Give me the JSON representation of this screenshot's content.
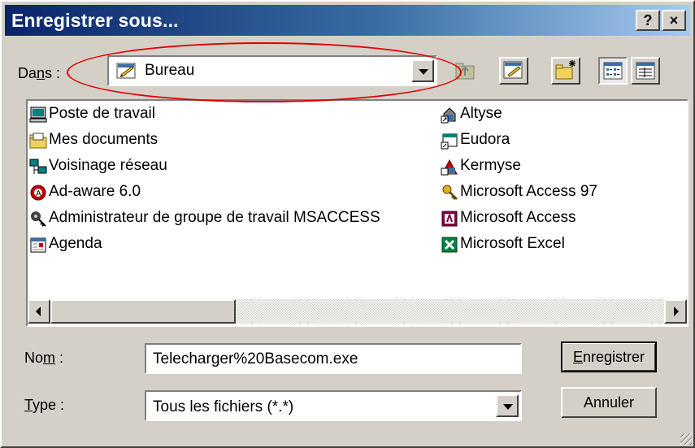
{
  "window": {
    "title": "Enregistrer sous...",
    "help_label": "?",
    "close_label": "×"
  },
  "location": {
    "label_prefix": "Da",
    "label_mnemonic": "n",
    "label_suffix": "s :",
    "value": "Bureau"
  },
  "toolbar": {
    "up_icon": "up-folder-icon",
    "desktop_icon": "desktop-icon",
    "new_folder_icon": "new-folder-icon",
    "list_view_icon": "list-view-icon",
    "details_view_icon": "details-view-icon"
  },
  "files": {
    "left": [
      {
        "label": "Poste de travail",
        "icon": "computer-icon"
      },
      {
        "label": "Mes documents",
        "icon": "folder-icon"
      },
      {
        "label": "Voisinage réseau",
        "icon": "network-icon"
      },
      {
        "label": "Ad-aware 6.0",
        "icon": "adaware-icon"
      },
      {
        "label": "Administrateur de groupe de travail MSACCESS",
        "icon": "admin-key-icon"
      },
      {
        "label": "Agenda",
        "icon": "agenda-icon"
      }
    ],
    "right": [
      {
        "label": "Altyse",
        "icon": "shortcut-icon"
      },
      {
        "label": "Eudora",
        "icon": "eudora-icon"
      },
      {
        "label": "Kermyse",
        "icon": "kermyse-icon"
      },
      {
        "label": "Microsoft Access 97",
        "icon": "key-icon"
      },
      {
        "label": "Microsoft Access",
        "icon": "access-icon"
      },
      {
        "label": "Microsoft Excel",
        "icon": "excel-icon"
      }
    ]
  },
  "name_field": {
    "label_prefix": "No",
    "label_mnemonic": "m",
    "label_suffix": " :",
    "value": "Telecharger%20Basecom.exe"
  },
  "type_field": {
    "label_mnemonic": "T",
    "label_suffix": "ype :",
    "value": "Tous les fichiers (*.*)"
  },
  "buttons": {
    "save_mnemonic": "E",
    "save_suffix": "nregistrer",
    "cancel": "Annuler"
  },
  "colors": {
    "title_gradient_start": "#0a246a",
    "title_gradient_end": "#a6caf0",
    "annotation_oval": "#e00000",
    "face": "#d4d0c8"
  }
}
